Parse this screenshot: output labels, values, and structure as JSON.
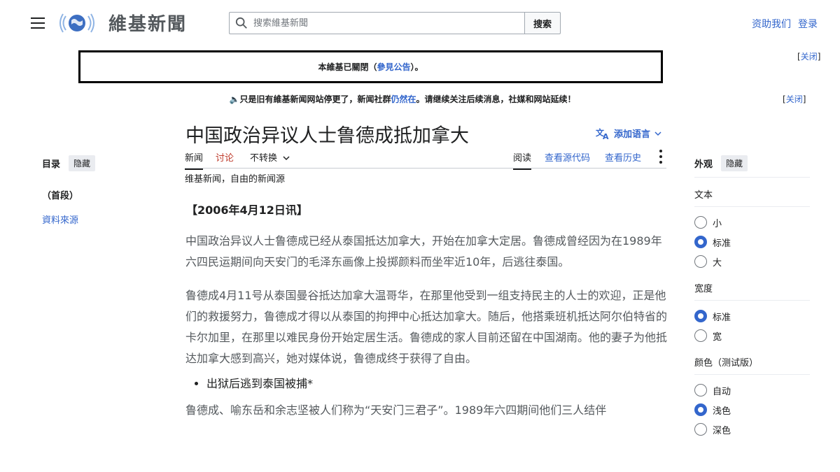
{
  "header": {
    "site_name": "維基新聞",
    "search_placeholder": "搜索維基新聞",
    "search_button": "搜索",
    "user_links": [
      "资助我们",
      "登录"
    ]
  },
  "notice": {
    "text_before": "本維基已關閉（",
    "link": "參見公告",
    "text_after": "）。",
    "close": "关闭"
  },
  "banner": {
    "text_before": "🔈只是旧有維基新闻网站停更了，新闻社群",
    "link": "仍然在",
    "text_after": "。请继续关注后续消息，社媒和网站延续！",
    "close": "关闭"
  },
  "page": {
    "title": "中国政治异议人士鲁德成抵加拿大",
    "add_languages": "添加语言",
    "tabs_left": [
      "新闻",
      "讨论",
      "不转换"
    ],
    "tabs_right": [
      "阅读",
      "查看源代码",
      "查看历史"
    ],
    "tagline": "维基新闻，自由的新闻源",
    "dateline": "【2006年4月12日讯】",
    "paragraphs": [
      "中国政治异议人士鲁德成已经从泰国抵达加拿大，开始在加拿大定居。鲁德成曾经因为在1989年六四民运期间向天安门的毛泽东画像上投掷颜料而坐牢近10年，后逃往泰国。",
      "鲁德成4月11号从泰国曼谷抵达加拿大温哥华，在那里他受到一组支持民主的人士的欢迎，正是他们的救援努力，鲁德成才得以从泰国的拘押中心抵达加拿大。随后，他搭乘班机抵达阿尔伯特省的卡尔加里，在那里以难民身份开始定居生活。鲁德成的家人目前还留在中国湖南。他的妻子为他抵达加拿大感到高兴，她对媒体说，鲁德成终于获得了自由。"
    ],
    "bullet": "出狱后逃到泰国被捕*",
    "paragraph3": "鲁德成、喻东岳和余志坚被人们称为“天安门三君子”。1989年六四期间他们三人结伴"
  },
  "toc": {
    "title": "目录",
    "hide": "隐藏",
    "items": [
      "（首段）",
      "資料來源"
    ]
  },
  "appearance": {
    "title": "外观",
    "hide": "隐藏",
    "text_section": "文本",
    "text_options": [
      "小",
      "标准",
      "大"
    ],
    "text_selected": 1,
    "width_section": "宽度",
    "width_options": [
      "标准",
      "宽"
    ],
    "width_selected": 0,
    "color_section": "颜色（测试版）",
    "color_options": [
      "自动",
      "浅色",
      "深色"
    ],
    "color_selected": 1,
    "accent_color": "#3366cc"
  }
}
